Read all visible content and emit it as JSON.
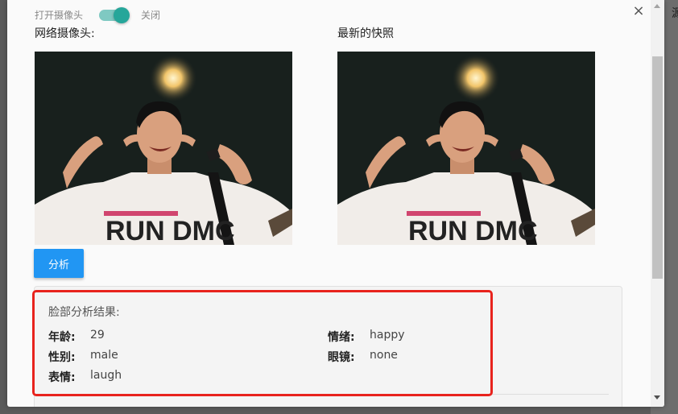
{
  "camera_toggle": {
    "on_label": "打开摄像头",
    "off_label": "关闭"
  },
  "webcam": {
    "label": "网络摄像头:"
  },
  "snapshot": {
    "label": "最新的快照"
  },
  "actions": {
    "analyze_label": "分析"
  },
  "results": {
    "title": "脸部分析结果:",
    "items": [
      {
        "key": "年龄:",
        "value": "29"
      },
      {
        "key": "性别:",
        "value": "male"
      },
      {
        "key": "表情:",
        "value": "laugh"
      },
      {
        "key": "情绪:",
        "value": "happy"
      },
      {
        "key": "眼镜:",
        "value": "none"
      }
    ]
  },
  "colors": {
    "accent_button": "#2196f3",
    "toggle": "#26a69a",
    "highlight": "#e8231d"
  },
  "background": {
    "partial_text": "源"
  },
  "photo_shirt_text": "RUN DMC"
}
